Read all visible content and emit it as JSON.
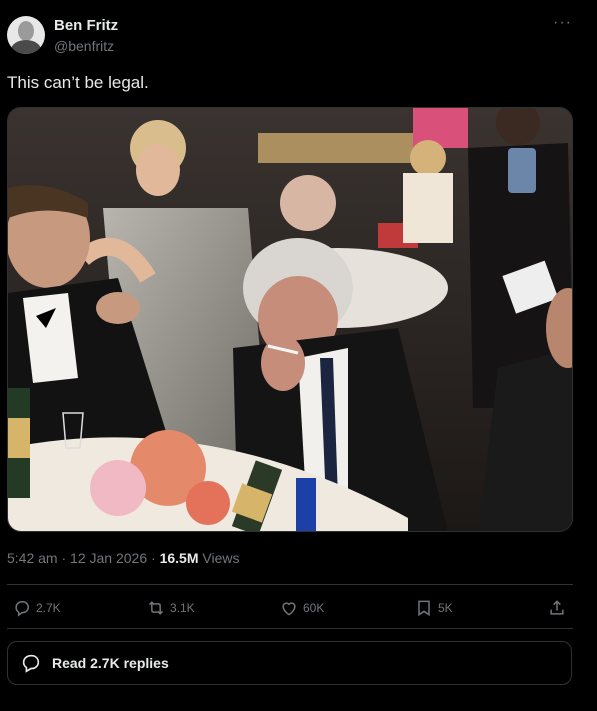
{
  "author": {
    "name": "Ben Fritz",
    "handle": "@benfritz"
  },
  "tweet": {
    "text": "This can’t be legal.",
    "time": "5:42 am",
    "separator": "·",
    "date": "12 Jan 2026",
    "views_count": "16.5M",
    "views_label": "Views",
    "more_label": "···"
  },
  "actions": {
    "replies": "2.7K",
    "retweets": "3.1K",
    "likes": "60K",
    "bookmarks": "5K"
  },
  "read_replies_label": "Read 2.7K replies",
  "icons": {
    "reply": "reply-icon",
    "retweet": "retweet-icon",
    "like": "heart-icon",
    "bookmark": "bookmark-icon",
    "share": "share-icon"
  },
  "colors": {
    "background": "#000000",
    "text": "#e7e9ea",
    "muted": "#71767b",
    "border": "#2f3336"
  }
}
